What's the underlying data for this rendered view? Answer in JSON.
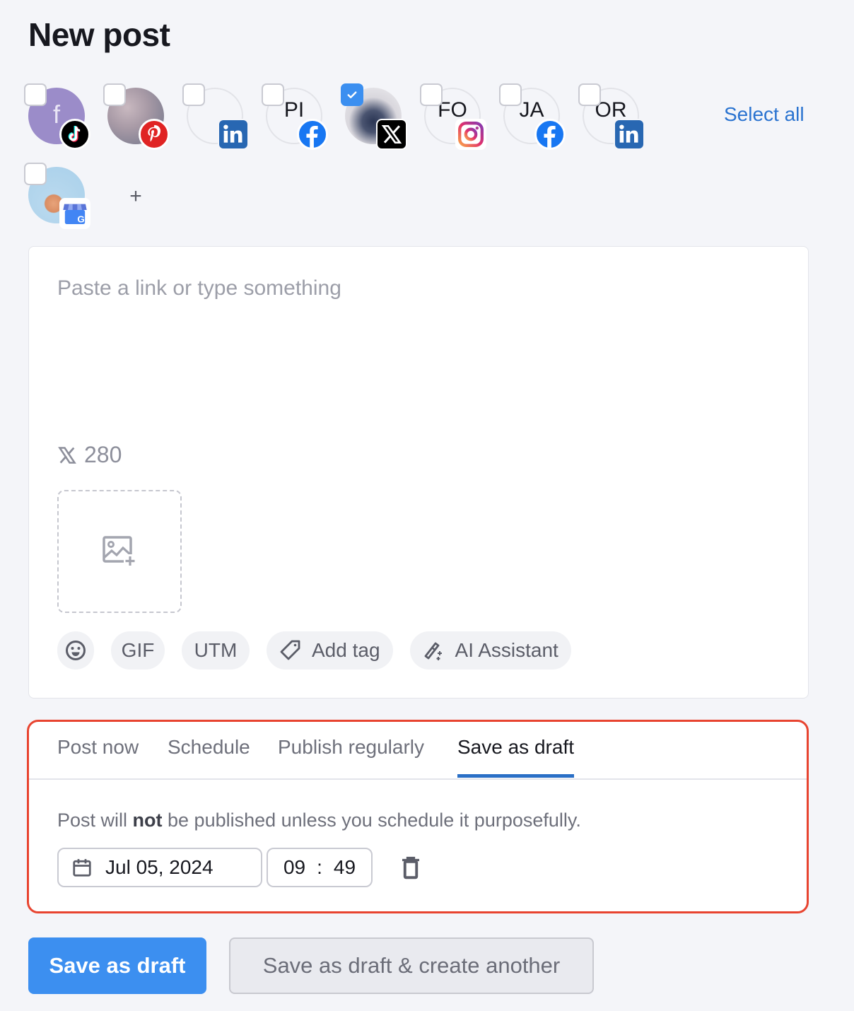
{
  "page": {
    "title": "New post"
  },
  "accounts": {
    "select_all_label": "Select all",
    "add_label": "+",
    "items": [
      {
        "initials": "f",
        "network": "tiktok",
        "checked": false,
        "avatar": "purple-initial"
      },
      {
        "initials": "",
        "network": "pinterest",
        "checked": false,
        "avatar": "photo"
      },
      {
        "initials": "",
        "network": "linkedin",
        "checked": false,
        "avatar": "empty"
      },
      {
        "initials": "PI",
        "network": "facebook",
        "checked": false,
        "avatar": "empty"
      },
      {
        "initials": "",
        "network": "x",
        "checked": true,
        "avatar": "photo"
      },
      {
        "initials": "FO",
        "network": "instagram",
        "checked": false,
        "avatar": "empty"
      },
      {
        "initials": "JA",
        "network": "facebook",
        "checked": false,
        "avatar": "empty"
      },
      {
        "initials": "OR",
        "network": "linkedin",
        "checked": false,
        "avatar": "empty"
      },
      {
        "initials": "",
        "network": "google-business",
        "checked": false,
        "avatar": "photo"
      }
    ]
  },
  "composer": {
    "placeholder": "Paste a link or type something",
    "value": "",
    "char_count_network": "x-icon",
    "char_count": "280",
    "media_icon": "add-image-icon",
    "toolbar": {
      "emoji_icon": "emoji-icon",
      "gif_label": "GIF",
      "utm_label": "UTM",
      "add_tag_label": "Add tag",
      "ai_label": "AI Assistant"
    }
  },
  "schedule": {
    "tabs": [
      "Post now",
      "Schedule",
      "Publish regularly",
      "Save as draft"
    ],
    "active_tab": "Save as draft",
    "notice_prefix": "Post will ",
    "notice_bold": "not",
    "notice_suffix": " be published unless you schedule it purposefully.",
    "date": "Jul 05, 2024",
    "time_hour": "09",
    "time_sep": ":",
    "time_minute": "49"
  },
  "actions": {
    "primary_label": "Save as draft",
    "secondary_label": "Save as draft & create another"
  },
  "colors": {
    "primary": "#3c8ff0",
    "link": "#2a73d0",
    "tab_active": "#2a6fc6",
    "highlight_border": "#e84430"
  }
}
